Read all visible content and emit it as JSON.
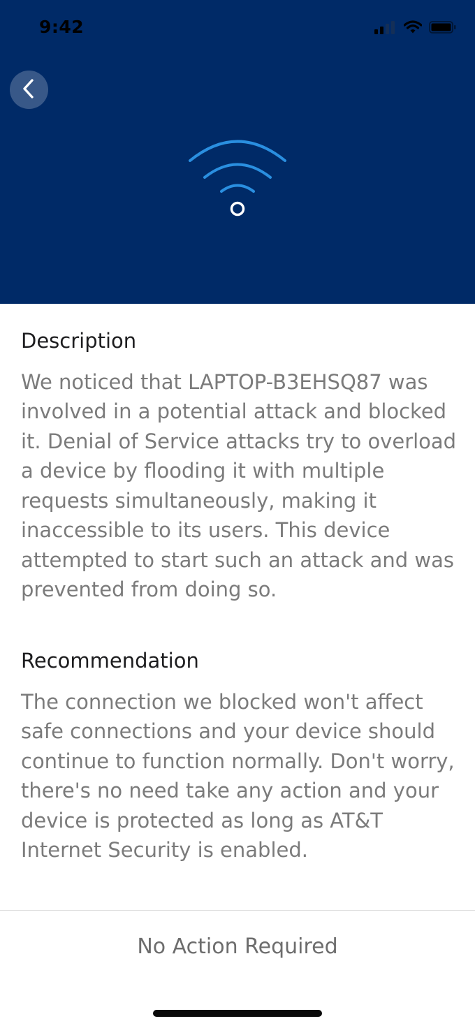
{
  "status_bar": {
    "time": "9:42",
    "icons": [
      "cellular-signal-icon",
      "wifi-icon",
      "battery-icon"
    ]
  },
  "header": {
    "back_icon": "chevron-left-icon",
    "hero_icon": "wifi-icon",
    "background_color": "#002a67",
    "accent_color": "#2a8fe0"
  },
  "description": {
    "title": "Description",
    "body": "We noticed that LAPTOP-B3EHSQ87 was involved in a potential attack and blocked it. Denial of Service attacks try to overload a device by flooding it with multiple requests simultaneously, making it inaccessible to its users. This device attempted to start such an attack and was prevented from doing so."
  },
  "recommendation": {
    "title": "Recommendation",
    "body": "The connection we blocked won't affect safe connections and your device should continue to function normally. Don't worry, there's no need take any action and your device is protected as long as AT&T Internet Security is enabled."
  },
  "footer": {
    "action_label": "No Action Required"
  }
}
